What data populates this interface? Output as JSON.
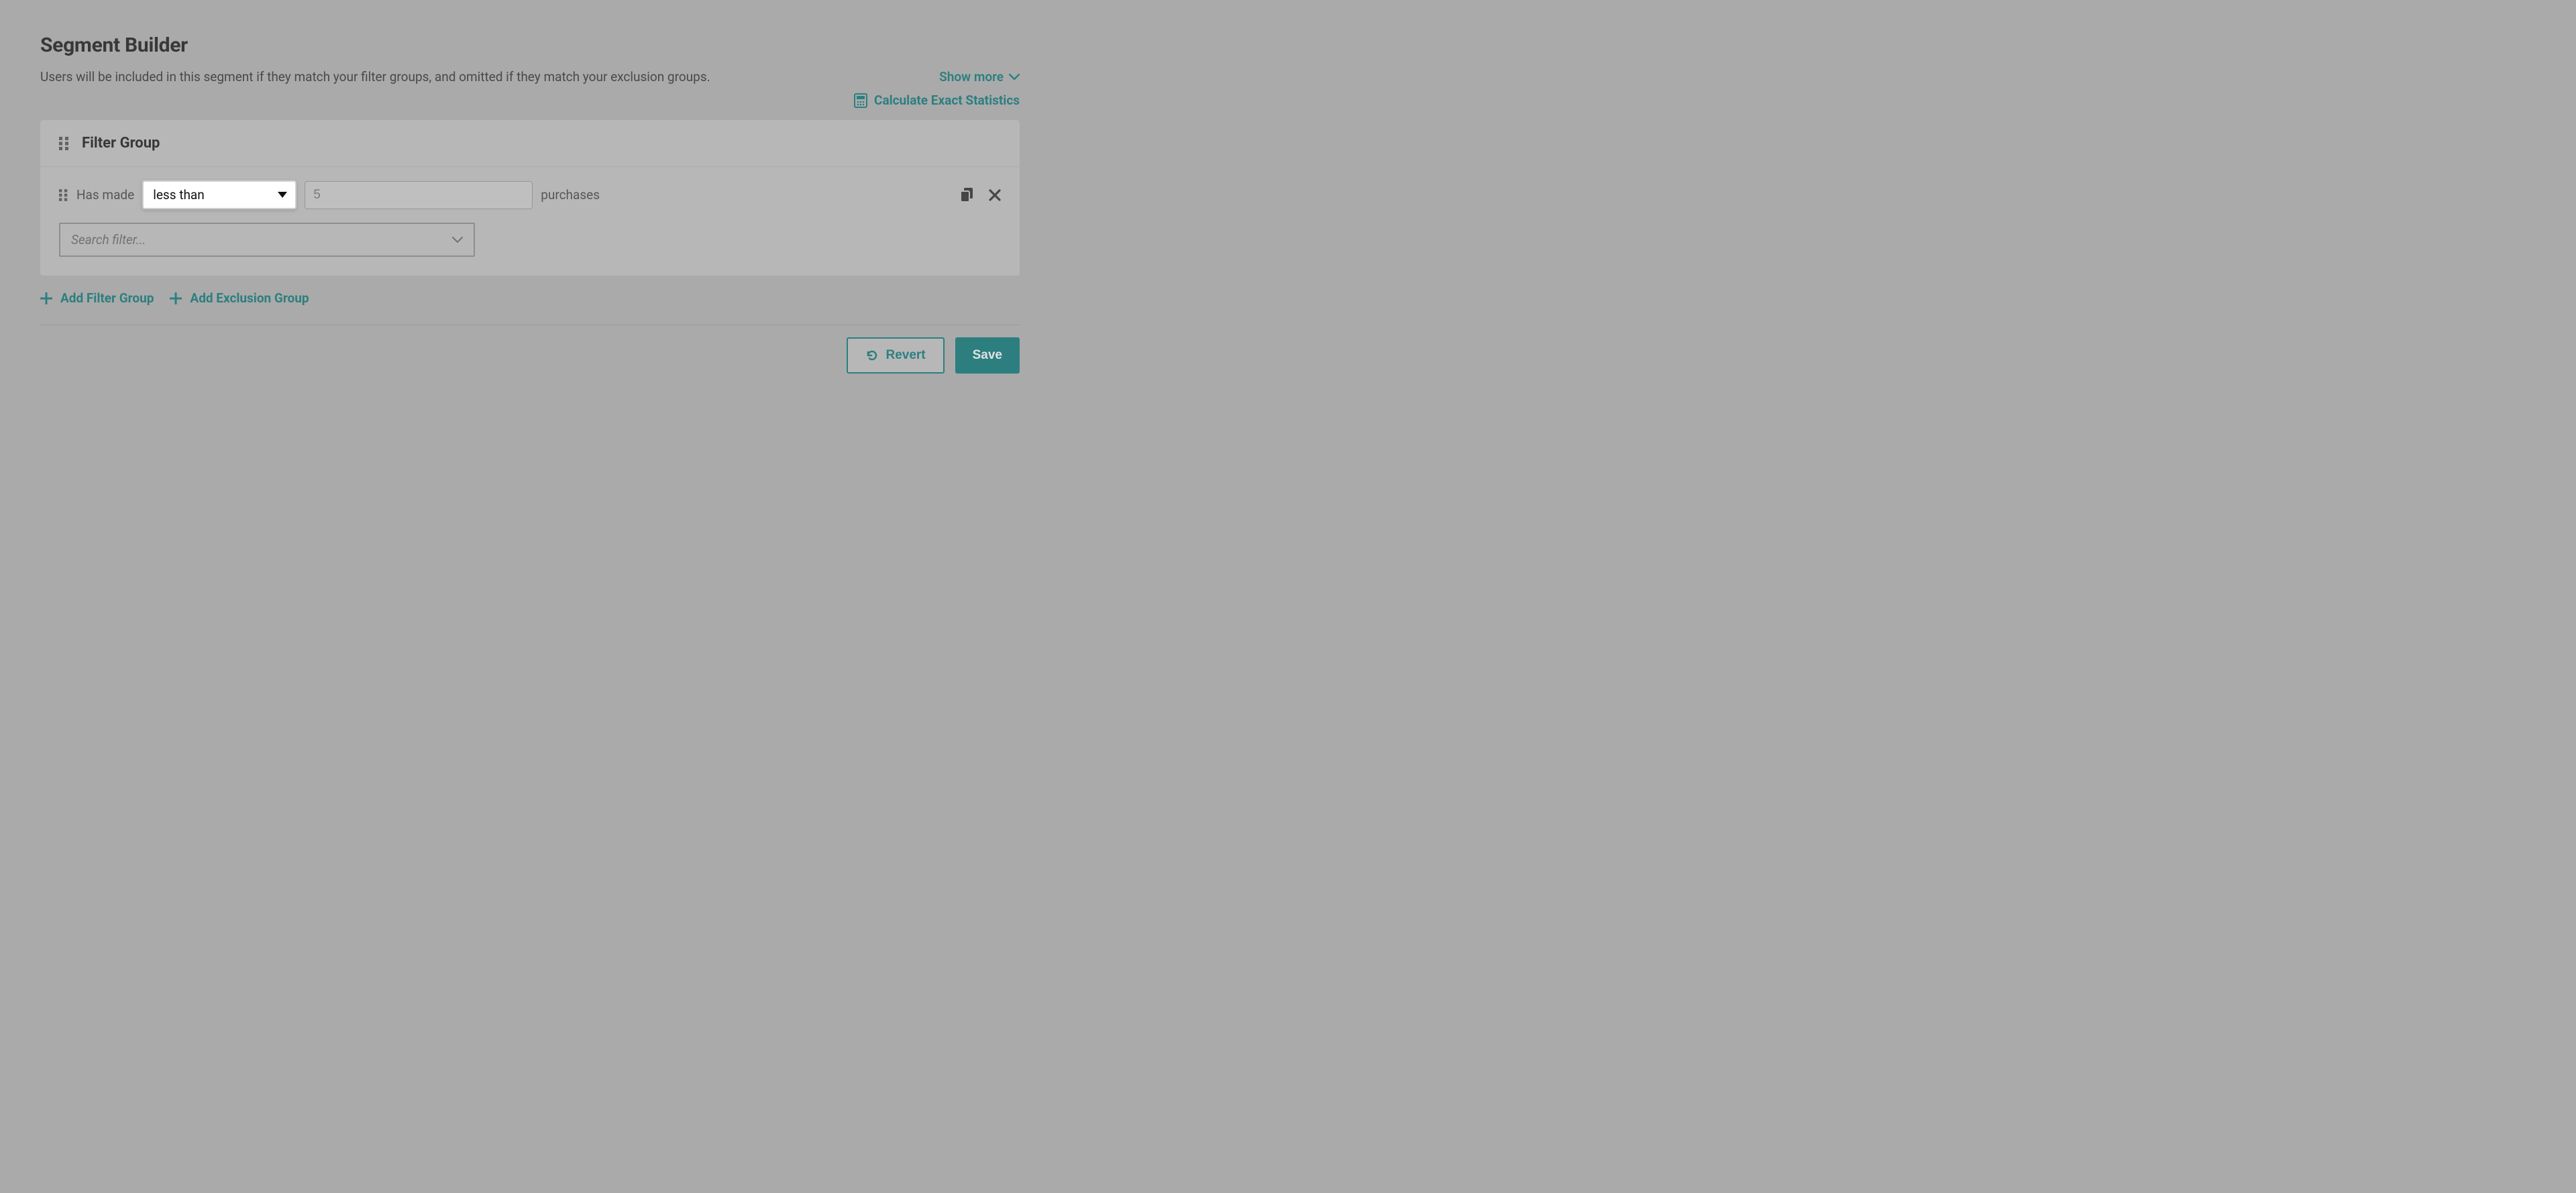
{
  "header": {
    "title": "Segment Builder",
    "description": "Users will be included in this segment if they match your filter groups, and omitted if they match your exclusion groups.",
    "show_more_label": "Show more",
    "calculate_label": "Calculate Exact Statistics"
  },
  "filter_group": {
    "title": "Filter Group",
    "row": {
      "prefix": "Has made",
      "operator": "less than",
      "value_placeholder": "5",
      "suffix": "purchases"
    },
    "search_placeholder": "Search filter..."
  },
  "actions": {
    "add_filter_group": "Add Filter Group",
    "add_exclusion_group": "Add Exclusion Group",
    "revert": "Revert",
    "save": "Save"
  },
  "colors": {
    "accent": "#0e7b7b"
  }
}
